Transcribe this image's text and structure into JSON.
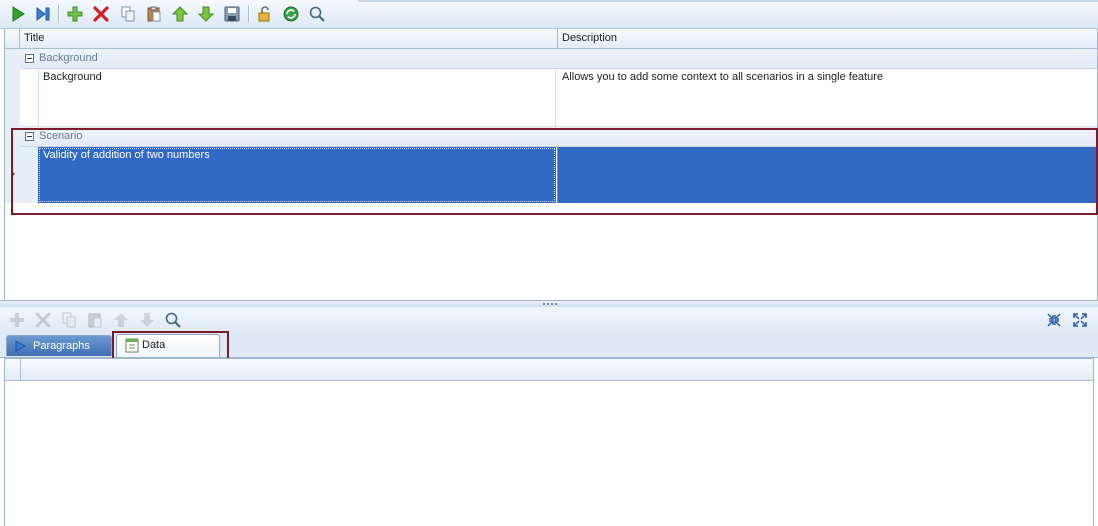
{
  "toolbar": {
    "buttons": [
      "run-icon",
      "step-icon",
      "add-icon",
      "delete-icon",
      "copy-icon",
      "paste-icon",
      "move-up-icon",
      "move-down-icon",
      "save-icon",
      "unlock-icon",
      "refresh-icon",
      "search-icon"
    ]
  },
  "grid": {
    "columns": {
      "title": "Title",
      "description": "Description"
    },
    "groups": [
      {
        "label": "Background",
        "row": {
          "title": "Background",
          "description": "Allows you to add some context to all scenarios in a single feature"
        }
      },
      {
        "label": "Scenario",
        "row": {
          "title": "Validity of addition of two numbers",
          "description": ""
        }
      }
    ]
  },
  "lower": {
    "tabs": {
      "paragraphs": "Paragraphs",
      "data": "Data"
    }
  },
  "colors": {
    "selection": "#316ac5",
    "highlight_border": "#7b1b2a"
  }
}
